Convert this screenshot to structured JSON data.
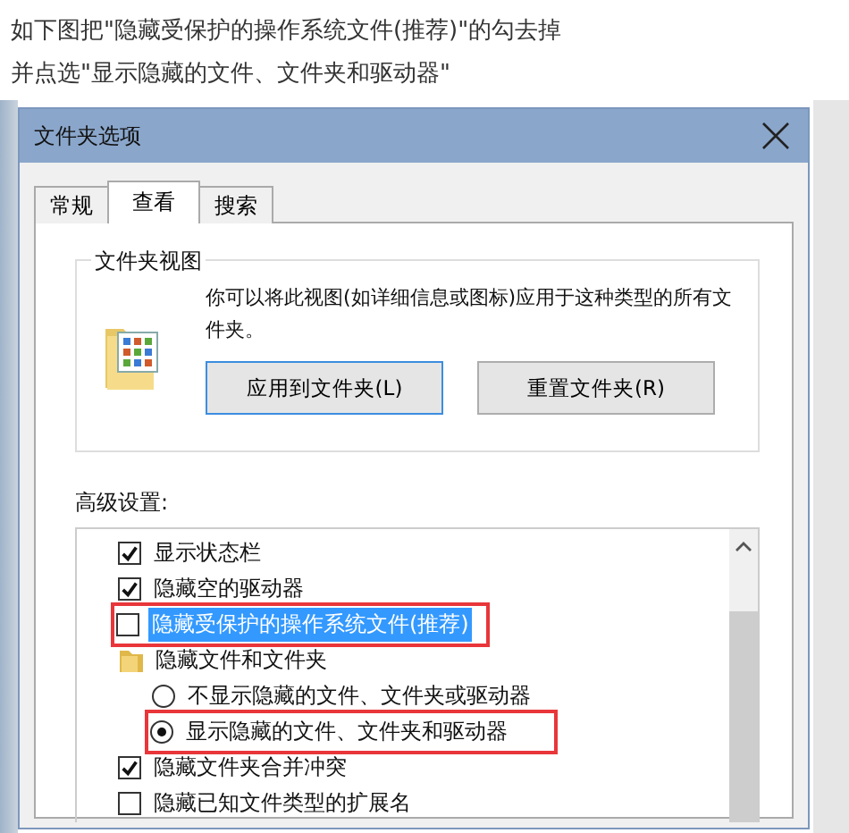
{
  "instructions": [
    "如下图把\"隐藏受保护的操作系统文件(推荐)\"的勾去掉",
    "并点选\"显示隐藏的文件、文件夹和驱动器\""
  ],
  "dialog": {
    "title": "文件夹选项",
    "tabs": [
      {
        "label": "常规",
        "selected": false
      },
      {
        "label": "查看",
        "selected": true
      },
      {
        "label": "搜索",
        "selected": false
      }
    ],
    "folder_views": {
      "legend": "文件夹视图",
      "description": "你可以将此视图(如详细信息或图标)应用于这种类型的所有文件夹。",
      "buttons": [
        {
          "label": "应用到文件夹(L)",
          "focused": true
        },
        {
          "label": "重置文件夹(R)",
          "focused": false
        }
      ]
    },
    "advanced": {
      "label": "高级设置:",
      "items": [
        {
          "kind": "checkbox",
          "label": "显示状态栏",
          "checked": true,
          "selected": false,
          "marked": false
        },
        {
          "kind": "checkbox",
          "label": "隐藏空的驱动器",
          "checked": true,
          "selected": false,
          "marked": false
        },
        {
          "kind": "checkbox",
          "label": "隐藏受保护的操作系统文件(推荐)",
          "checked": false,
          "selected": true,
          "marked": true
        },
        {
          "kind": "folder",
          "label": "隐藏文件和文件夹",
          "children": [
            {
              "kind": "radio",
              "label": "不显示隐藏的文件、文件夹或驱动器",
              "checked": false,
              "selected": false,
              "marked": false
            },
            {
              "kind": "radio",
              "label": "显示隐藏的文件、文件夹和驱动器",
              "checked": true,
              "selected": false,
              "marked": true
            }
          ]
        },
        {
          "kind": "checkbox",
          "label": "隐藏文件夹合并冲突",
          "checked": true,
          "selected": false,
          "marked": false
        },
        {
          "kind": "checkbox",
          "label": "隐藏已知文件类型的扩展名",
          "checked": false,
          "selected": false,
          "marked": false
        }
      ]
    }
  }
}
